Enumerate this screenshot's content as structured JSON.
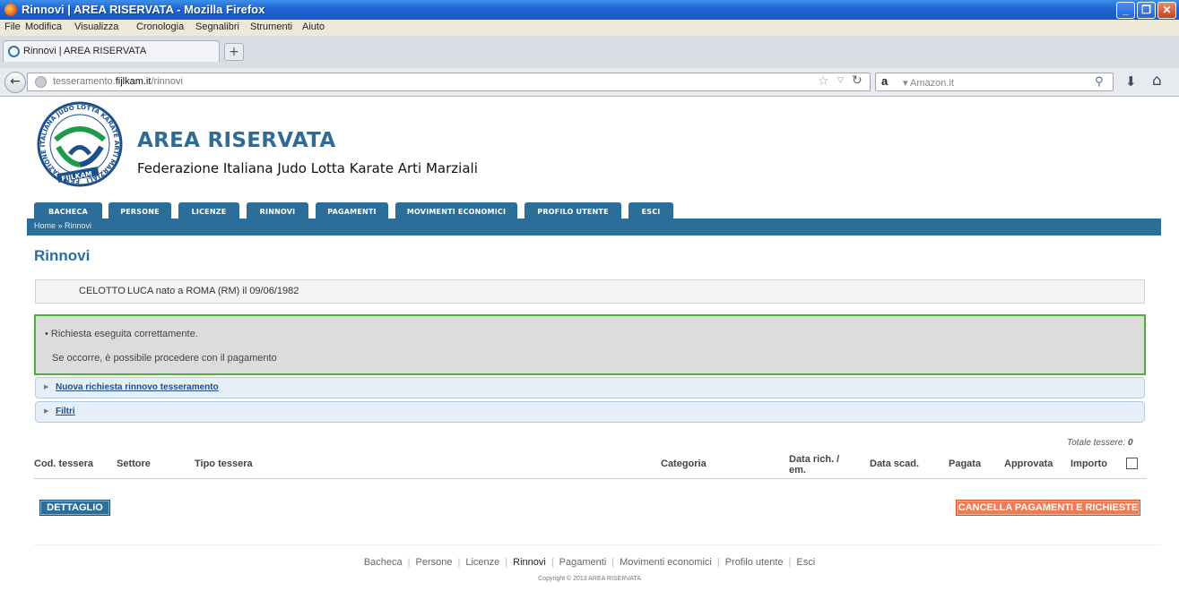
{
  "window": {
    "title": "Rinnovi | AREA RISERVATA - Mozilla Firefox"
  },
  "menu": [
    "File",
    "Modifica",
    "Visualizza",
    "Cronologia",
    "Segnalibri",
    "Strumenti",
    "Aiuto"
  ],
  "tab": {
    "label": "Rinnovi | AREA RISERVATA",
    "new_tab": "+"
  },
  "address": {
    "prefix": "tesseramento.",
    "domain": "fijlkam.it",
    "path": "/rinnovi"
  },
  "search": {
    "engine_label": "a",
    "placeholder": "Amazon.it"
  },
  "site": {
    "title": "AREA RISERVATA",
    "subtitle": "Federazione Italiana Judo Lotta Karate Arti Marziali",
    "logo_text_ring": "FEDERAZIONE ITALIANA JUDO LOTTA KARATE ARTI MARZIALI",
    "logo_text_banner": "FIJLKAM"
  },
  "nav": [
    "BACHECA",
    "PERSONE",
    "LICENZE",
    "RINNOVI",
    "PAGAMENTI",
    "MOVIMENTI ECONOMICI",
    "PROFILO UTENTE",
    "ESCI"
  ],
  "breadcrumb": "Home » Rinnovi",
  "page_title": "Rinnovi",
  "person": {
    "surname": "CELOTTO",
    "details": "LUCA nato a ROMA (RM) il 09/06/1982"
  },
  "message": {
    "line1": "• Richiesta eseguita correttamente.",
    "line2": "Se occorre, è possibile procedere con il pagamento"
  },
  "accordions": {
    "new_request": "Nuova richiesta rinnovo tesseramento",
    "filters": "Filtri"
  },
  "totals": {
    "label": "Totale tessere:",
    "value": "0"
  },
  "table": {
    "columns": {
      "cod": "Cod. tessera",
      "settore": "Settore",
      "tipo": "Tipo tessera",
      "categoria": "Categoria",
      "data_rich_1": "Data rich. /",
      "data_rich_2": "em.",
      "data_scad": "Data scad.",
      "pagata": "Pagata",
      "approvata": "Approvata",
      "importo": "Importo"
    }
  },
  "buttons": {
    "dettaglio": "DETTAGLIO",
    "cancella": "CANCELLA PAGAMENTI E RICHIESTE"
  },
  "footer": {
    "links": [
      "Bacheca",
      "Persone",
      "Licenze",
      "Rinnovi",
      "Pagamenti",
      "Movimenti economici",
      "Profilo utente",
      "Esci"
    ],
    "active": "Rinnovi",
    "copyright": "Copyright © 2013 AREA RISERVATA"
  },
  "colors": {
    "brand_blue": "#2b6e99",
    "success_border": "#4caf3a",
    "danger_button": "#f07a52"
  }
}
